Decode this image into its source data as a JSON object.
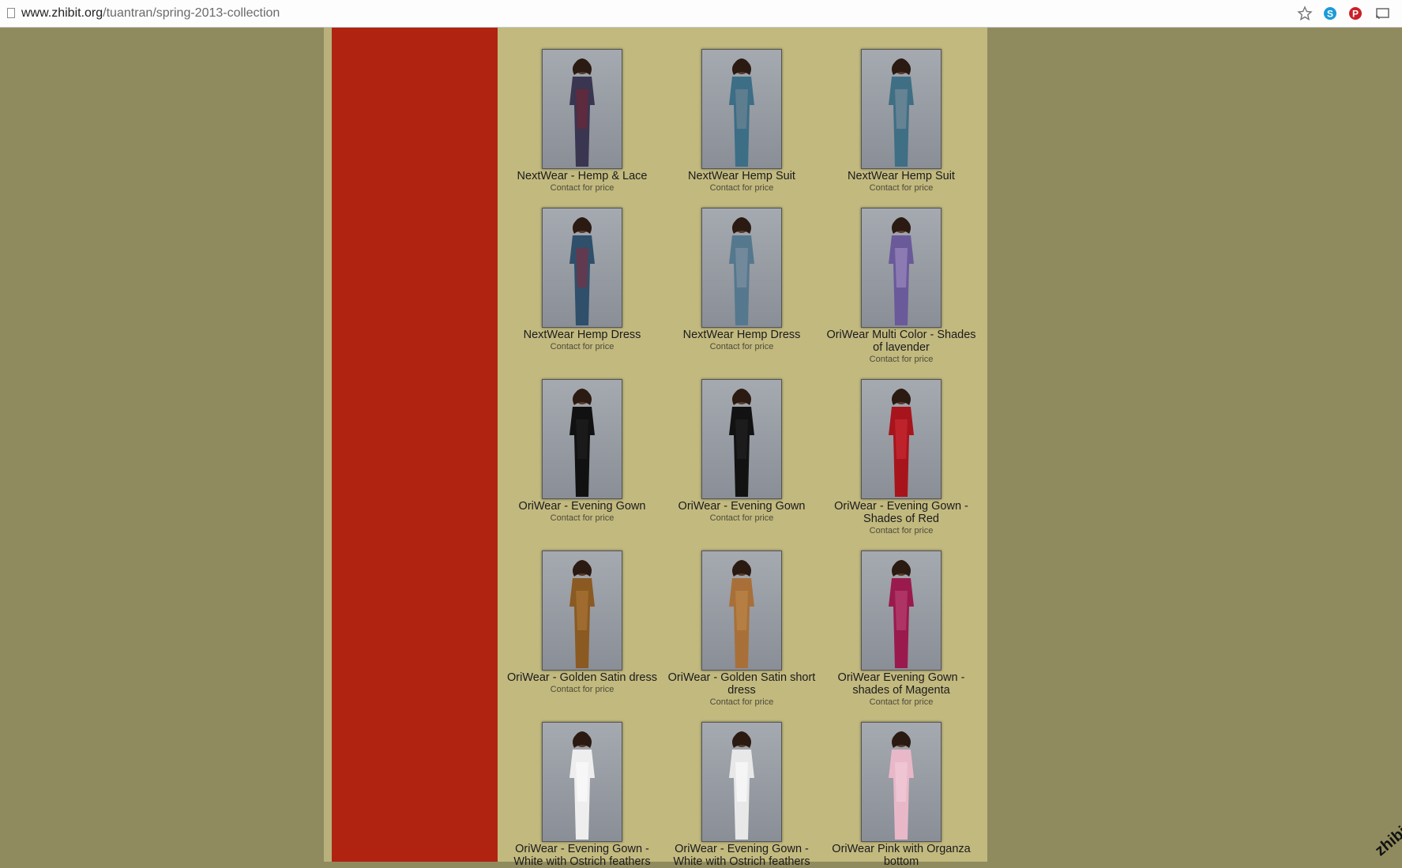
{
  "browser": {
    "url_domain": "www.zhibit.org",
    "url_path": "/tuantran/spring-2013-collection"
  },
  "colors": {
    "page_bg": "#908b5e",
    "sidebar": "#b12311",
    "content_bg": "#c2b97f"
  },
  "items": [
    {
      "name": "NextWear - Hemp & Lace",
      "price": "Contact for price",
      "dress": "#3a3550",
      "accent": "#7a2030"
    },
    {
      "name": "NextWear Hemp Suit",
      "price": "Contact for price",
      "dress": "#3c6e86",
      "accent": "#7a8a98"
    },
    {
      "name": "NextWear Hemp Suit",
      "price": "Contact for price",
      "dress": "#3f6f84",
      "accent": "#8594a0"
    },
    {
      "name": "NextWear Hemp Dress",
      "price": "Contact for price",
      "dress": "#2f4f6a",
      "accent": "#8a2a3a"
    },
    {
      "name": "NextWear Hemp Dress",
      "price": "Contact for price",
      "dress": "#55788e",
      "accent": "#8a98a8"
    },
    {
      "name": "OriWear Multi Color - Shades of lavender",
      "price": "Contact for price",
      "dress": "#6a5a9a",
      "accent": "#a896c8"
    },
    {
      "name": "OriWear - Evening Gown",
      "price": "Contact for price",
      "dress": "#111111",
      "accent": "#222222"
    },
    {
      "name": "OriWear - Evening Gown",
      "price": "Contact for price",
      "dress": "#121212",
      "accent": "#242424"
    },
    {
      "name": "OriWear - Evening Gown - Shades of Red",
      "price": "Contact for price",
      "dress": "#a8141c",
      "accent": "#d0303a"
    },
    {
      "name": "OriWear - Golden Satin dress",
      "price": "Contact for price",
      "dress": "#8a5a22",
      "accent": "#b07a3a"
    },
    {
      "name": "OriWear - Golden Satin short dress",
      "price": "Contact for price",
      "dress": "#a87038",
      "accent": "#c08a4c"
    },
    {
      "name": "OriWear Evening Gown - shades of Magenta",
      "price": "Contact for price",
      "dress": "#9a1a4e",
      "accent": "#c04a7a"
    },
    {
      "name": "OriWear - Evening Gown - White with Ostrich feathers",
      "price": "",
      "dress": "#eeeeee",
      "accent": "#ffffff"
    },
    {
      "name": "OriWear - Evening Gown - White with Ostrich feathers",
      "price": "",
      "dress": "#e8e8e8",
      "accent": "#ffffff"
    },
    {
      "name": "OriWear Pink with Organza bottom",
      "price": "",
      "dress": "#e8b8c8",
      "accent": "#f4d0dc"
    }
  ],
  "watermark": "zhibit"
}
